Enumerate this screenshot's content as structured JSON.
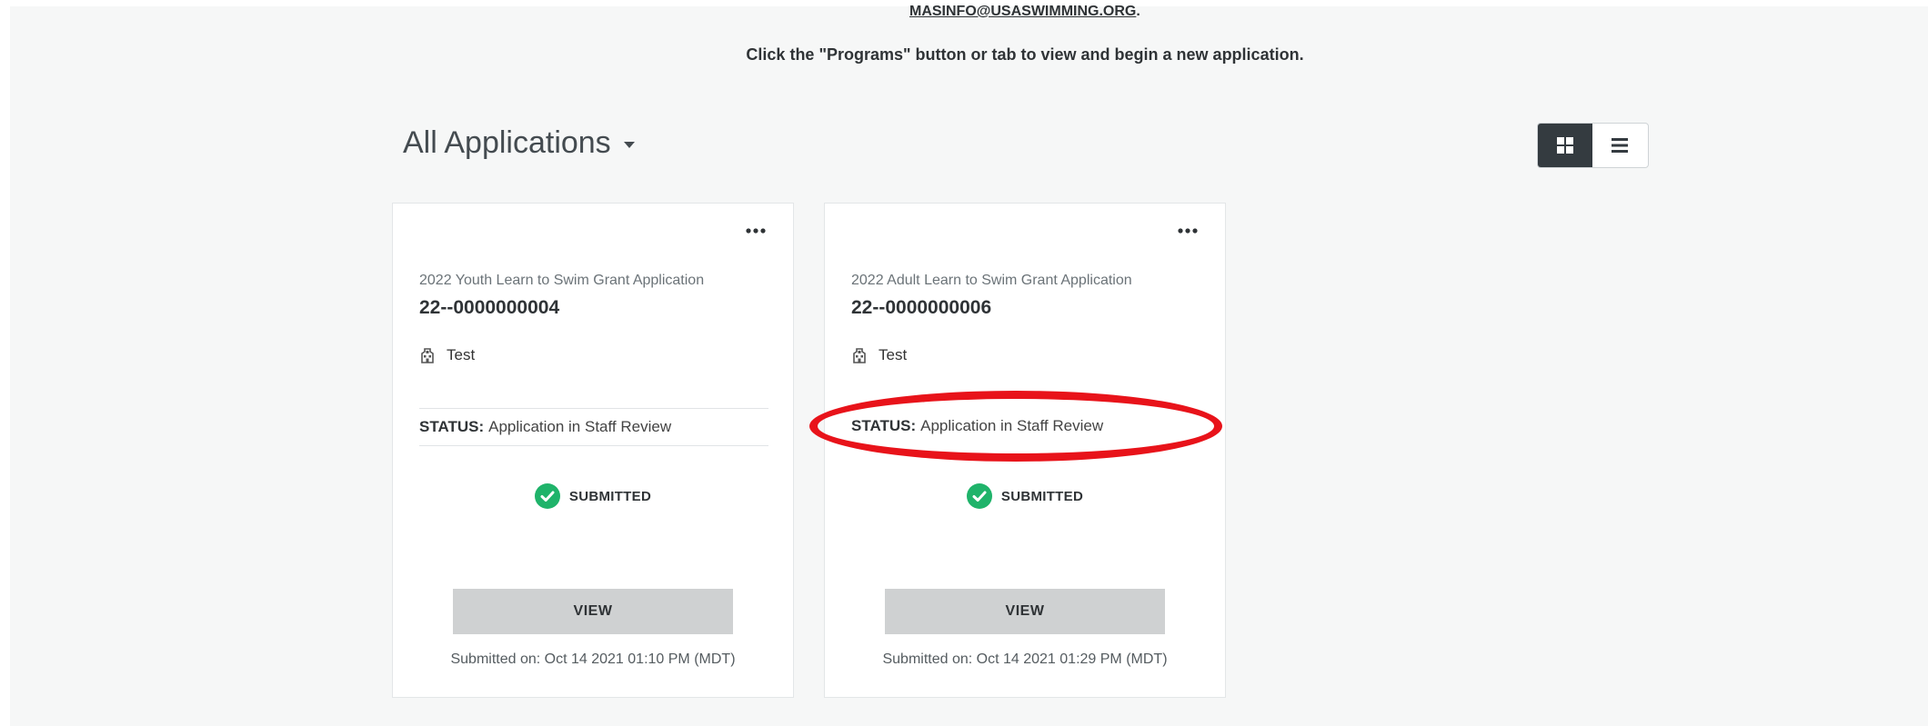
{
  "header": {
    "contact_email": "MASINFO@USASWIMMING.ORG",
    "contact_suffix": ".",
    "instruction": "Click the \"Programs\" button or tab to view and begin a new application."
  },
  "applications_header": {
    "title": "All Applications",
    "view_modes": [
      "grid",
      "list"
    ],
    "active_view": "grid"
  },
  "cards": [
    {
      "program_name": "2022 Youth Learn to Swim Grant Application",
      "application_number": "22--0000000004",
      "organization": "Test",
      "status_label": "STATUS:",
      "status_value": "Application in Staff Review",
      "submission_state": "SUBMITTED",
      "view_label": "VIEW",
      "submitted_on": "Submitted on: Oct 14 2021 01:10 PM (MDT)"
    },
    {
      "program_name": "2022 Adult Learn to Swim Grant Application",
      "application_number": "22--0000000006",
      "organization": "Test",
      "status_label": "STATUS:",
      "status_value": "Application in Staff Review",
      "submission_state": "SUBMITTED",
      "view_label": "VIEW",
      "submitted_on": "Submitted on: Oct 14 2021 01:29 PM (MDT)"
    }
  ],
  "colors": {
    "page_background": "#f6f7f7",
    "active_toggle": "#343b40",
    "success_green": "#1fb36a",
    "annotation_red": "#e8131a",
    "view_button": "#cfd1d2"
  },
  "icons": {
    "grid_view": "grid-icon",
    "list_view": "list-icon",
    "more_menu": "ellipsis-icon",
    "organization": "building-icon",
    "submitted": "check-circle-icon"
  }
}
